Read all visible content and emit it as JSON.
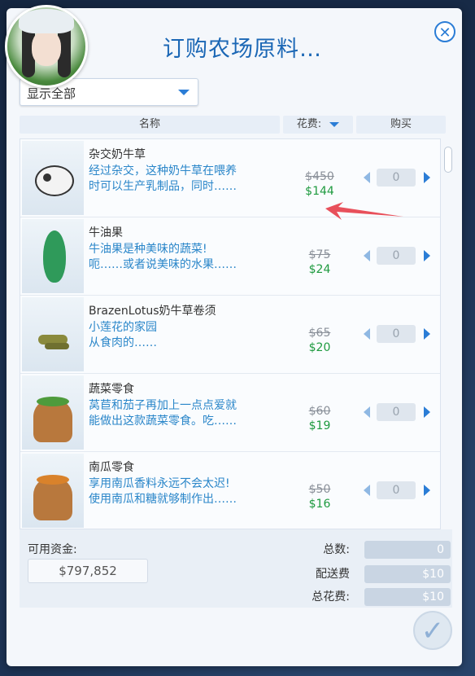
{
  "dialog": {
    "title": "订购农场原料…",
    "close_icon": "close-icon"
  },
  "filter": {
    "label": "显示全部"
  },
  "columns": {
    "name": "名称",
    "cost": "花费:",
    "buy": "购买"
  },
  "items": [
    {
      "name": "杂交奶牛草",
      "desc_line1": "经过杂交，这种奶牛草在喂养",
      "desc_line2": "时可以生产乳制品，同时……",
      "price_old": "$450",
      "price_new": "$144",
      "quantity": "0"
    },
    {
      "name": "牛油果",
      "desc_line1": "牛油果是种美味的蔬菜!",
      "desc_line2": "呃……或者说美味的水果……",
      "price_old": "$75",
      "price_new": "$24",
      "quantity": "0"
    },
    {
      "name": "BrazenLotus奶牛草卷须",
      "desc_line1": "小莲花的家园",
      "desc_line2": "从食肉的……",
      "price_old": "$65",
      "price_new": "$20",
      "quantity": "0"
    },
    {
      "name": "蔬菜零食",
      "desc_line1": "莴苣和茄子再加上一点点爱就",
      "desc_line2": "能做出这款蔬菜零食。吃……",
      "price_old": "$60",
      "price_new": "$19",
      "quantity": "0"
    },
    {
      "name": "南瓜零食",
      "desc_line1": "享用南瓜香料永远不会太迟!",
      "desc_line2": "使用南瓜和糖就够制作出……",
      "price_old": "$50",
      "price_new": "$16",
      "quantity": "0"
    }
  ],
  "summary": {
    "funds_label": "可用资金:",
    "funds_value": "$797,852",
    "total_count_label": "总数:",
    "total_count_value": "0",
    "delivery_label": "配送费",
    "delivery_value": "$10",
    "total_cost_label": "总花费:",
    "total_cost_value": "$10"
  },
  "colors": {
    "accent": "#2b7dd6",
    "price_green": "#1e9a3f",
    "annotation_red": "#e8505b"
  }
}
